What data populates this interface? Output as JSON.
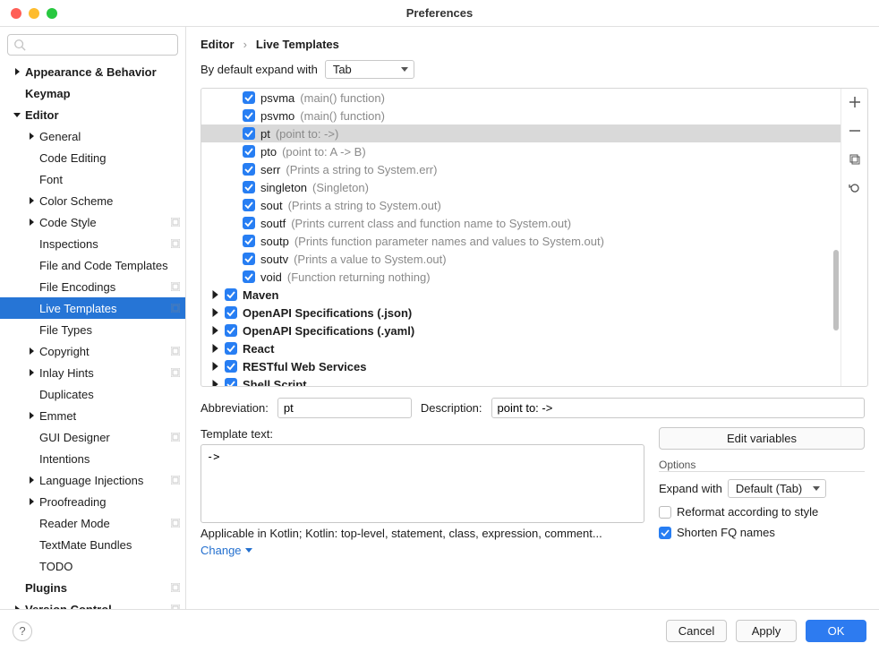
{
  "window_title": "Preferences",
  "search": {
    "placeholder": ""
  },
  "sidebar": [
    {
      "label": "Appearance & Behavior",
      "indent": 0,
      "arrow": "right",
      "bold": true,
      "marker": false
    },
    {
      "label": "Keymap",
      "indent": 0,
      "arrow": "",
      "bold": true,
      "marker": false
    },
    {
      "label": "Editor",
      "indent": 0,
      "arrow": "down",
      "bold": true,
      "marker": false
    },
    {
      "label": "General",
      "indent": 1,
      "arrow": "right",
      "bold": false,
      "marker": false
    },
    {
      "label": "Code Editing",
      "indent": 1,
      "arrow": "",
      "bold": false,
      "marker": false
    },
    {
      "label": "Font",
      "indent": 1,
      "arrow": "",
      "bold": false,
      "marker": false
    },
    {
      "label": "Color Scheme",
      "indent": 1,
      "arrow": "right",
      "bold": false,
      "marker": false
    },
    {
      "label": "Code Style",
      "indent": 1,
      "arrow": "right",
      "bold": false,
      "marker": true
    },
    {
      "label": "Inspections",
      "indent": 1,
      "arrow": "",
      "bold": false,
      "marker": true
    },
    {
      "label": "File and Code Templates",
      "indent": 1,
      "arrow": "",
      "bold": false,
      "marker": false
    },
    {
      "label": "File Encodings",
      "indent": 1,
      "arrow": "",
      "bold": false,
      "marker": true
    },
    {
      "label": "Live Templates",
      "indent": 1,
      "arrow": "",
      "bold": false,
      "marker": true,
      "selected": true
    },
    {
      "label": "File Types",
      "indent": 1,
      "arrow": "",
      "bold": false,
      "marker": false
    },
    {
      "label": "Copyright",
      "indent": 1,
      "arrow": "right",
      "bold": false,
      "marker": true
    },
    {
      "label": "Inlay Hints",
      "indent": 1,
      "arrow": "right",
      "bold": false,
      "marker": true
    },
    {
      "label": "Duplicates",
      "indent": 1,
      "arrow": "",
      "bold": false,
      "marker": false
    },
    {
      "label": "Emmet",
      "indent": 1,
      "arrow": "right",
      "bold": false,
      "marker": false
    },
    {
      "label": "GUI Designer",
      "indent": 1,
      "arrow": "",
      "bold": false,
      "marker": true
    },
    {
      "label": "Intentions",
      "indent": 1,
      "arrow": "",
      "bold": false,
      "marker": false
    },
    {
      "label": "Language Injections",
      "indent": 1,
      "arrow": "right",
      "bold": false,
      "marker": true
    },
    {
      "label": "Proofreading",
      "indent": 1,
      "arrow": "right",
      "bold": false,
      "marker": false
    },
    {
      "label": "Reader Mode",
      "indent": 1,
      "arrow": "",
      "bold": false,
      "marker": true
    },
    {
      "label": "TextMate Bundles",
      "indent": 1,
      "arrow": "",
      "bold": false,
      "marker": false
    },
    {
      "label": "TODO",
      "indent": 1,
      "arrow": "",
      "bold": false,
      "marker": false
    },
    {
      "label": "Plugins",
      "indent": 0,
      "arrow": "",
      "bold": true,
      "marker": true
    },
    {
      "label": "Version Control",
      "indent": 0,
      "arrow": "right",
      "bold": true,
      "marker": true
    }
  ],
  "breadcrumb": {
    "a": "Editor",
    "b": "Live Templates"
  },
  "expand": {
    "label": "By default expand with",
    "value": "Tab"
  },
  "templates": [
    {
      "type": "item",
      "abbr": "psvma",
      "desc": "(main() function)"
    },
    {
      "type": "item",
      "abbr": "psvmo",
      "desc": "(main() function)"
    },
    {
      "type": "item",
      "abbr": "pt",
      "desc": "(point to: ->)",
      "selected": true
    },
    {
      "type": "item",
      "abbr": "pto",
      "desc": "(point to: A -> B)"
    },
    {
      "type": "item",
      "abbr": "serr",
      "desc": "(Prints a string to System.err)"
    },
    {
      "type": "item",
      "abbr": "singleton",
      "desc": "(Singleton)"
    },
    {
      "type": "item",
      "abbr": "sout",
      "desc": "(Prints a string to System.out)"
    },
    {
      "type": "item",
      "abbr": "soutf",
      "desc": "(Prints current class and function name to System.out)"
    },
    {
      "type": "item",
      "abbr": "soutp",
      "desc": "(Prints function parameter names and values to System.out)"
    },
    {
      "type": "item",
      "abbr": "soutv",
      "desc": "(Prints a value to System.out)"
    },
    {
      "type": "item",
      "abbr": "void",
      "desc": "(Function returning nothing)"
    },
    {
      "type": "group",
      "abbr": "Maven"
    },
    {
      "type": "group",
      "abbr": "OpenAPI Specifications (.json)"
    },
    {
      "type": "group",
      "abbr": "OpenAPI Specifications (.yaml)"
    },
    {
      "type": "group",
      "abbr": "React"
    },
    {
      "type": "group",
      "abbr": "RESTful Web Services"
    },
    {
      "type": "group",
      "abbr": "Shell Script"
    }
  ],
  "detail": {
    "abbr_label": "Abbreviation:",
    "abbr_value": "pt",
    "desc_label": "Description:",
    "desc_value": "point to: ->",
    "tmpl_label": "Template text:",
    "tmpl_value": "->",
    "edit_vars": "Edit variables",
    "options_label": "Options",
    "expand_with_label": "Expand with",
    "expand_with_value": "Default (Tab)",
    "reformat_label": "Reformat according to style",
    "shorten_label": "Shorten FQ names",
    "applicable": "Applicable in Kotlin; Kotlin: top-level, statement, class, expression, comment...",
    "change": "Change"
  },
  "footer": {
    "cancel": "Cancel",
    "apply": "Apply",
    "ok": "OK"
  }
}
